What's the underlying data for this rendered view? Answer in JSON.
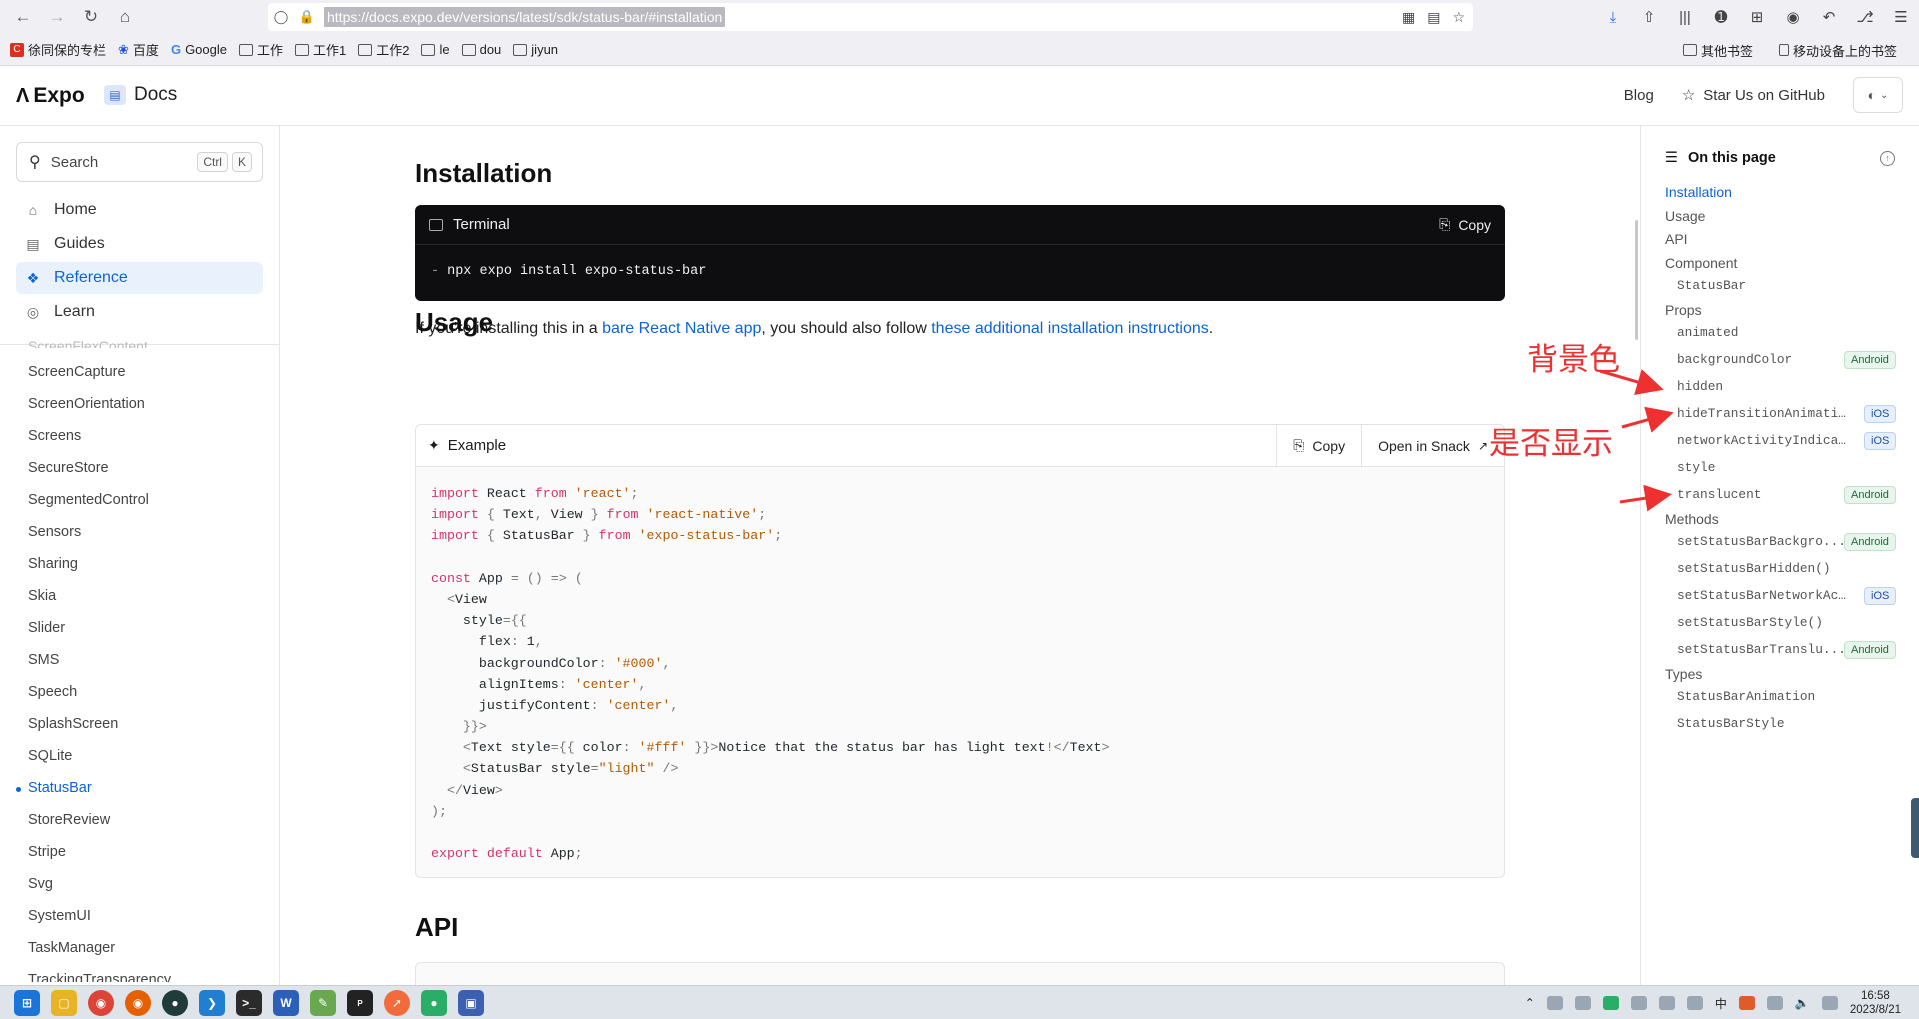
{
  "browser": {
    "url": "https://docs.expo.dev/versions/latest/sdk/status-bar/#installation",
    "bookmarks": [
      "徐同保的专栏",
      "百度",
      "Google",
      "工作",
      "工作1",
      "工作2",
      "le",
      "dou",
      "jiyun"
    ],
    "bookmarks_right": [
      "其他书签",
      "移动设备上的书签"
    ]
  },
  "header": {
    "logo": "Expo",
    "docs": "Docs",
    "blog": "Blog",
    "star": "Star Us on GitHub"
  },
  "sidebar": {
    "search_label": "Search",
    "shortcut_ctrl": "Ctrl",
    "shortcut_k": "K",
    "nav": [
      {
        "label": "Home",
        "icon": "home-icon"
      },
      {
        "label": "Guides",
        "icon": "book-icon"
      },
      {
        "label": "Reference",
        "icon": "reference-icon"
      },
      {
        "label": "Learn",
        "icon": "learn-icon"
      }
    ],
    "sdk_cut": "ScreenFlexContent",
    "sdk_items": [
      "ScreenCapture",
      "ScreenOrientation",
      "Screens",
      "SecureStore",
      "SegmentedControl",
      "Sensors",
      "Sharing",
      "Skia",
      "Slider",
      "SMS",
      "Speech",
      "SplashScreen",
      "SQLite",
      "StatusBar",
      "StoreReview",
      "Stripe",
      "Svg",
      "SystemUI",
      "TaskManager",
      "TrackingTransparency"
    ],
    "active_sdk": "StatusBar"
  },
  "main": {
    "installation_title": "Installation",
    "terminal_title": "Terminal",
    "copy_label": "Copy",
    "terminal_cmd": "npx expo install expo-status-bar",
    "para_pre": "If you're installing this in a ",
    "para_link1": "bare React Native app",
    "para_mid": ", you should also follow ",
    "para_link2": "these additional installation instructions",
    "para_post": ".",
    "usage_title": "Usage",
    "example_title": "Example",
    "snack_label": "Open in Snack",
    "api_title": "API",
    "code_lines": [
      "import React from 'react';",
      "import { Text, View } from 'react-native';",
      "import { StatusBar } from 'expo-status-bar';",
      "",
      "const App = () => (",
      "  <View",
      "    style={{",
      "      flex: 1,",
      "      backgroundColor: '#000',",
      "      alignItems: 'center',",
      "      justifyContent: 'center',",
      "    }}>",
      "    <Text style={{ color: '#fff' }}>Notice that the status bar has light text!</Text>",
      "    <StatusBar style=\"light\" />",
      "  </View>",
      ");",
      "",
      "export default App;"
    ]
  },
  "toc": {
    "title": "On this page",
    "items": [
      {
        "label": "Installation",
        "kind": "section",
        "active": true
      },
      {
        "label": "Usage",
        "kind": "section"
      },
      {
        "label": "API",
        "kind": "section"
      },
      {
        "label": "Component",
        "kind": "section"
      },
      {
        "label": "StatusBar",
        "kind": "sub"
      },
      {
        "label": "Props",
        "kind": "section"
      },
      {
        "label": "animated",
        "kind": "sub"
      },
      {
        "label": "backgroundColor",
        "kind": "sub",
        "badge": "Android"
      },
      {
        "label": "hidden",
        "kind": "sub"
      },
      {
        "label": "hideTransitionAnimation",
        "kind": "sub",
        "badge": "iOS"
      },
      {
        "label": "networkActivityIndicat...",
        "kind": "sub",
        "badge": "iOS"
      },
      {
        "label": "style",
        "kind": "sub"
      },
      {
        "label": "translucent",
        "kind": "sub",
        "badge": "Android"
      },
      {
        "label": "Methods",
        "kind": "section"
      },
      {
        "label": "setStatusBarBackgro...",
        "kind": "sub",
        "badge": "Android"
      },
      {
        "label": "setStatusBarHidden()",
        "kind": "sub"
      },
      {
        "label": "setStatusBarNetworkAct...",
        "kind": "sub",
        "badge": "iOS"
      },
      {
        "label": "setStatusBarStyle()",
        "kind": "sub"
      },
      {
        "label": "setStatusBarTranslu...",
        "kind": "sub",
        "badge": "Android"
      },
      {
        "label": "Types",
        "kind": "section"
      },
      {
        "label": "StatusBarAnimation",
        "kind": "sub"
      },
      {
        "label": "StatusBarStyle",
        "kind": "sub"
      }
    ]
  },
  "annotations": {
    "bg_color": "背景色",
    "show_hide": "是否显示",
    "color": "#ee3030"
  },
  "taskbar": {
    "time": "16:58",
    "date": "2023/8/21"
  },
  "colors": {
    "accent": "#0b63d6",
    "android_badge": "#1b6d35",
    "ios_badge": "#1a4fa3",
    "terminal_bg": "#0e0e10"
  }
}
